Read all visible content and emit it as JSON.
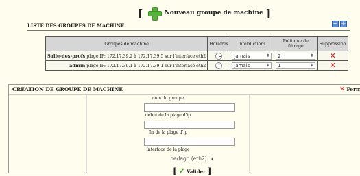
{
  "top_action": {
    "open_bracket": "[",
    "label": "Nouveau groupe de machine",
    "close_bracket": "]",
    "icon": "plus-icon"
  },
  "list": {
    "title": "LISTE DES GROUPES DE MACHINE",
    "collapse_label": "−",
    "expand_label": "+",
    "headers": {
      "groups": "Groupes de machine",
      "hours": "Horaires",
      "bans": "Interdictions",
      "policy": "Politique de filtrage",
      "delete": "Suppression"
    },
    "rows": [
      {
        "name": "Salle-des-profs",
        "desc": " plage IP: 172.17.39.2 à 172.17.39.5 sur l'interface eth2",
        "ban": "Jamais",
        "policy": "2"
      },
      {
        "name": "admin",
        "desc": " plage IP: 172.17.39.1 à 172.17.39.1 sur l'interface eth2",
        "ban": "Jamais",
        "policy": "1"
      }
    ],
    "colors": {
      "delete": "#dd2222",
      "accent": "#5b8fd6"
    }
  },
  "create": {
    "title": "CRÉATION DE GROUPE DE MACHINE",
    "close_label": "Ferm",
    "fields": {
      "name_label": "nom du groupe",
      "start_label": "début de la plage d'ip",
      "end_label": "fin de la plage d'ip",
      "iface_label": "Interface de la plage",
      "iface_value": "pedago (eth2)"
    },
    "submit_label": "Valider"
  }
}
